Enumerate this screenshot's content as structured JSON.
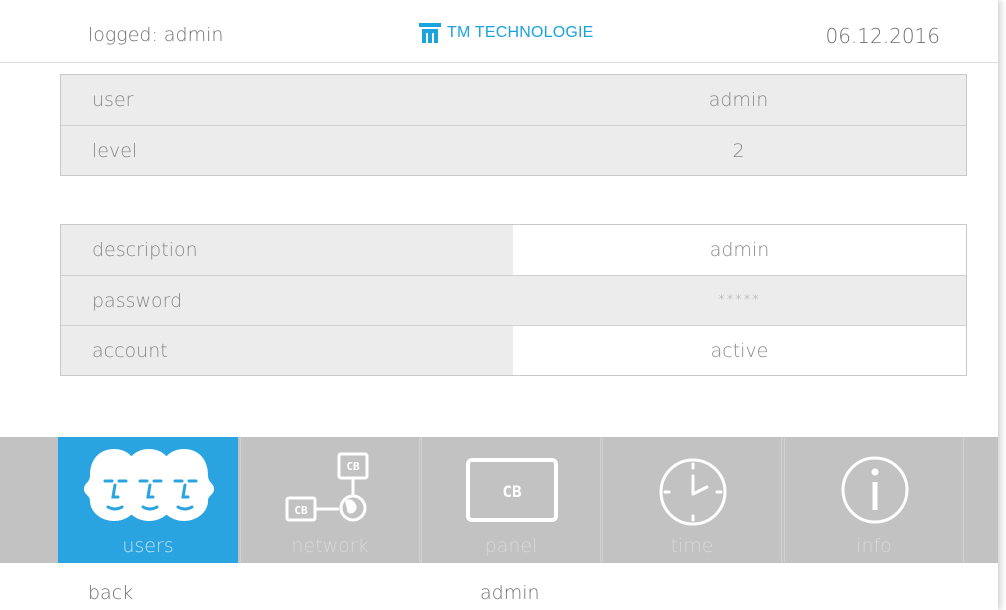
{
  "header": {
    "logged_text": "logged: admin",
    "logo_text": "TM TECHNOLOGIE",
    "date": "06.12.2016"
  },
  "user_table": [
    {
      "label": "user",
      "value": "admin"
    },
    {
      "label": "level",
      "value": "2"
    }
  ],
  "detail_table": [
    {
      "label": "description",
      "value": "admin"
    },
    {
      "label": "password",
      "value": "*****"
    },
    {
      "label": "account",
      "value": "active"
    }
  ],
  "nav": [
    {
      "label": "users",
      "icon": "users-icon",
      "active": true
    },
    {
      "label": "network",
      "icon": "network-icon",
      "active": false
    },
    {
      "label": "panel",
      "icon": "panel-icon",
      "active": false
    },
    {
      "label": "time",
      "icon": "clock-icon",
      "active": false
    },
    {
      "label": "info",
      "icon": "info-icon",
      "active": false
    }
  ],
  "nav_icon_text": {
    "cb": "CB"
  },
  "footer": {
    "back_label": "back",
    "current_user": "admin"
  },
  "colors": {
    "accent": "#2aa4e0",
    "logo": "#1aa3dc",
    "nav_bg": "#c2c2c2",
    "row_bg": "#ececec"
  }
}
